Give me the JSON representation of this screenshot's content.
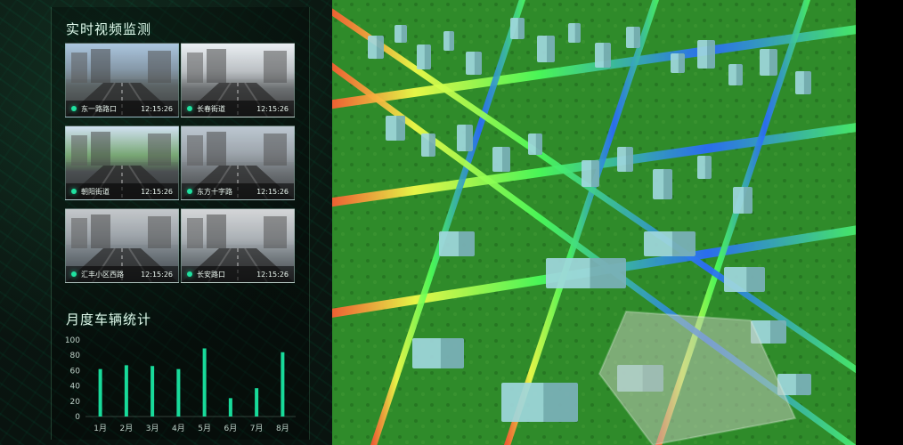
{
  "video_section": {
    "title": "实时视频监测",
    "tiles": [
      {
        "location": "东一路路口",
        "time": "12:15:26",
        "status_color": "#1fe2a0",
        "icon": "status-dot-icon"
      },
      {
        "location": "长春街道",
        "time": "12:15:26",
        "status_color": "#1fe2a0",
        "icon": "status-dot-icon"
      },
      {
        "location": "朝阳街道",
        "time": "12:15:26",
        "status_color": "#1fe2a0",
        "icon": "status-dot-icon"
      },
      {
        "location": "东方十字路",
        "time": "12:15:26",
        "status_color": "#1fe2a0",
        "icon": "status-dot-icon"
      },
      {
        "location": "汇丰小区西路",
        "time": "12:15:26",
        "status_color": "#1fe2a0",
        "icon": "status-dot-icon"
      },
      {
        "location": "长安路口",
        "time": "12:15:26",
        "status_color": "#1fe2a0",
        "icon": "status-dot-icon"
      }
    ]
  },
  "monthly_section": {
    "title": "月度车辆统计"
  },
  "chart_data": {
    "type": "bar",
    "title": "",
    "xlabel": "",
    "ylabel": "",
    "categories": [
      "1月",
      "2月",
      "3月",
      "4月",
      "5月",
      "6月",
      "7月",
      "8月"
    ],
    "values": [
      62,
      67,
      66,
      62,
      89,
      24,
      37,
      84
    ],
    "ylim": [
      0,
      100
    ],
    "yticks": [
      0,
      20,
      40,
      60,
      80,
      100
    ],
    "grid": false,
    "bar_color": "#19e6a2"
  },
  "map_view": {
    "theme_colors": {
      "grass": "#2f8b2a",
      "road_blue": "#2a6bff",
      "road_green": "#4cff5b",
      "road_red": "#ff3b2f",
      "road_yellow": "#f4ff4a",
      "building": "#9fd7dd"
    }
  }
}
